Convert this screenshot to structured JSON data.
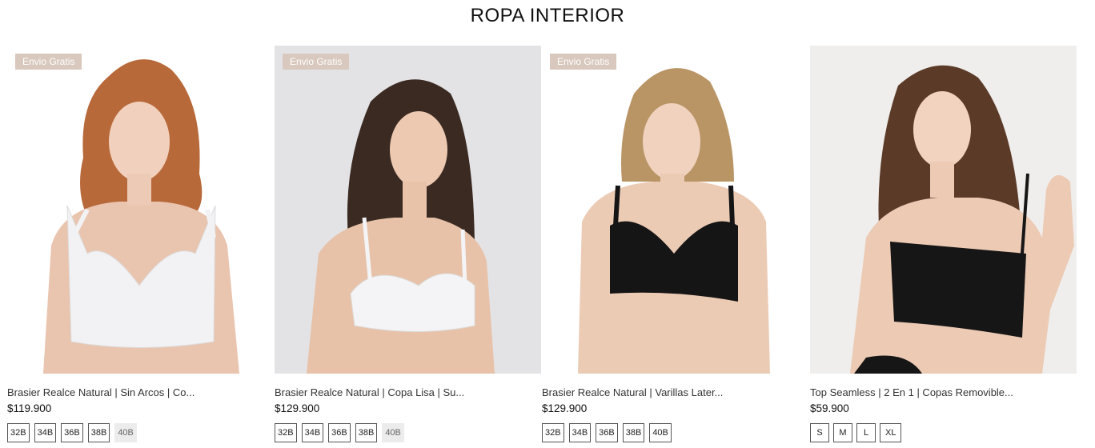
{
  "section": {
    "title": "ROPA INTERIOR"
  },
  "products": [
    {
      "badge": "Envio Gratis",
      "name": "Brasier Realce Natural | Sin Arcos | Co...",
      "price": "$119.900",
      "sizes": [
        {
          "label": "32B"
        },
        {
          "label": "34B"
        },
        {
          "label": "36B"
        },
        {
          "label": "38B"
        },
        {
          "label": "40B"
        }
      ],
      "garment_color": "#f2f2f4",
      "hair_color": "#b8693a"
    },
    {
      "badge": "Envio Gratis",
      "name": "Brasier Realce Natural | Copa Lisa | Su...",
      "price": "$129.900",
      "sizes": [
        {
          "label": "32B"
        },
        {
          "label": "34B"
        },
        {
          "label": "36B"
        },
        {
          "label": "38B"
        },
        {
          "label": "40B"
        }
      ],
      "garment_color": "#f4f4f6",
      "hair_color": "#3a2a22"
    },
    {
      "badge": "Envio Gratis",
      "name": "Brasier Realce Natural | Varillas Later...",
      "price": "$129.900",
      "sizes": [
        {
          "label": "32B"
        },
        {
          "label": "34B"
        },
        {
          "label": "36B"
        },
        {
          "label": "38B"
        },
        {
          "label": "40B"
        }
      ],
      "garment_color": "#151515",
      "hair_color": "#b99465"
    },
    {
      "badge": "",
      "name": "Top Seamless | 2 En 1 | Copas Removible...",
      "price": "$59.900",
      "sizes": [
        {
          "label": "S"
        },
        {
          "label": "M"
        },
        {
          "label": "L"
        },
        {
          "label": "XL"
        }
      ],
      "garment_color": "#161616",
      "hair_color": "#5b3a28"
    }
  ]
}
